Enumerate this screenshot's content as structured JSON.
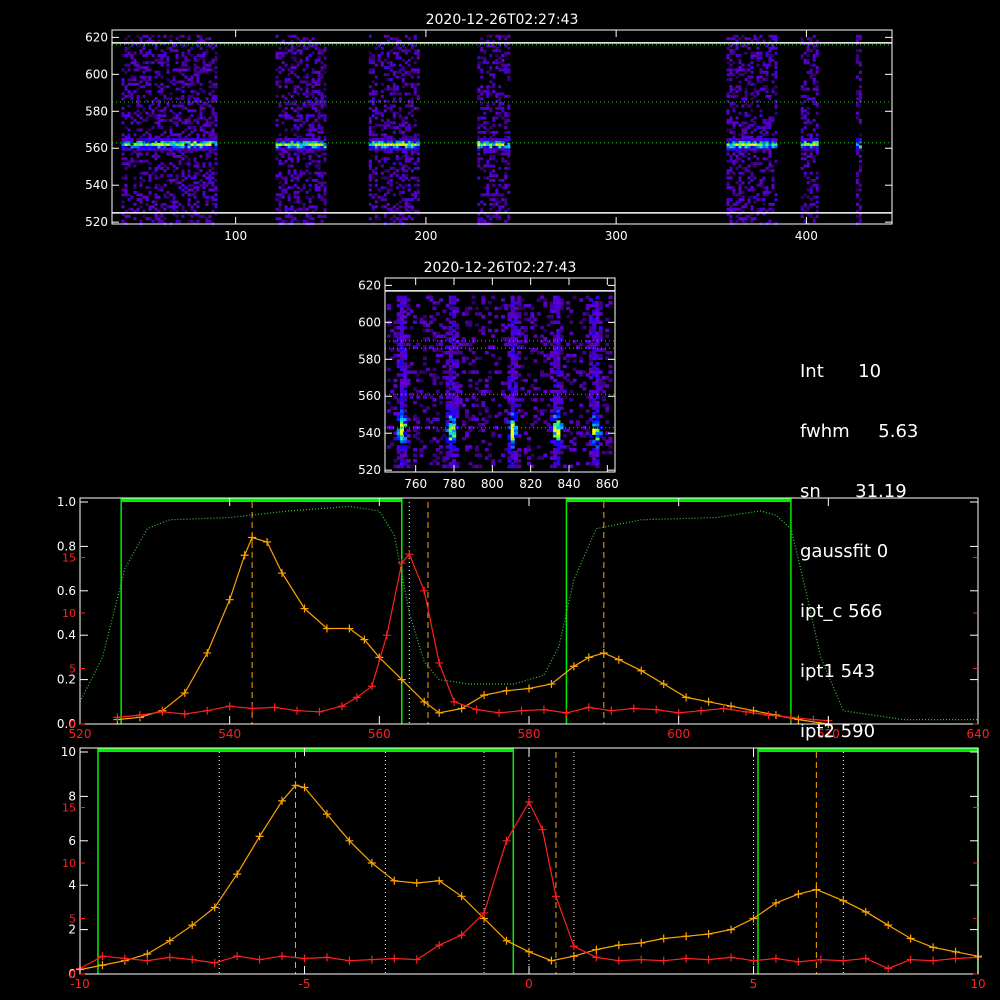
{
  "colors": {
    "background": "#000000",
    "axis": "#ffffff",
    "green_band": "#00ee00",
    "orange": "#ffa500",
    "red": "#ff2020",
    "filter_curve": "#33cc33",
    "guide_lines": "#ffa500"
  },
  "info_panel": {
    "int_label": "Int",
    "int_value": "10",
    "fwhm_label": "fwhm",
    "fwhm_value": "5.63",
    "sn_label": "sn",
    "sn_value": "31.19",
    "gaussfit_label": "gaussfit",
    "gaussfit_value": "0",
    "ipt_c_label": "ipt_c",
    "ipt_c_value": "566",
    "ipt1_label": "ipt1",
    "ipt1_value": "543",
    "ipt2_label": "ipt2",
    "ipt2_value": "590"
  },
  "chart_data": [
    {
      "type": "heatmap",
      "title": "2020-12-26T02:27:43",
      "xlim": [
        35,
        445
      ],
      "ylim": [
        519,
        624
      ],
      "xticks": [
        100,
        200,
        300,
        400
      ],
      "yticks": [
        520,
        540,
        560,
        580,
        600,
        620
      ],
      "hlines_solid": [
        525,
        617
      ],
      "hlines_dotted": [
        563,
        585,
        616
      ],
      "column_bands": [
        [
          40,
          90
        ],
        [
          121,
          147
        ],
        [
          170,
          196
        ],
        [
          227,
          244
        ],
        [
          358,
          384
        ],
        [
          397,
          405
        ],
        [
          426,
          429
        ]
      ],
      "bright_rows": [
        563
      ],
      "colormap": "rainbow"
    },
    {
      "type": "heatmap",
      "title": "2020-12-26T02:27:43",
      "xlim": [
        744,
        864
      ],
      "ylim": [
        519,
        624
      ],
      "xticks": [
        760,
        780,
        800,
        820,
        840,
        860
      ],
      "yticks": [
        520,
        540,
        560,
        580,
        600,
        620
      ],
      "hlines_solid": [
        617
      ],
      "hlines_dotted": [
        543,
        561,
        586,
        590
      ],
      "bright_columns": [
        752,
        778,
        810,
        833,
        853
      ],
      "bright_rows": [
        543
      ],
      "colormap": "rainbow"
    },
    {
      "type": "line",
      "xlim": [
        520,
        640
      ],
      "xticks": [
        520,
        540,
        560,
        580,
        600,
        620,
        640
      ],
      "ylim_left": [
        0,
        1.0
      ],
      "yticks_left": [
        "0.0",
        "0.2",
        "0.4",
        "0.6",
        "0.8",
        "1.0"
      ],
      "ylim_right": [
        0,
        20
      ],
      "yticks_right": [
        "0",
        "5",
        "10",
        "15"
      ],
      "green_bands": [
        [
          525.5,
          563
        ],
        [
          585,
          615
        ]
      ],
      "dashed_lines": [
        543,
        566.5,
        590
      ],
      "dotted_lines": [
        564
      ],
      "series": [
        {
          "color": "orange",
          "axis": "left",
          "markers": true,
          "x": [
            525,
            528,
            531,
            534,
            537,
            540,
            542,
            543,
            545,
            547,
            550,
            553,
            556,
            558,
            560,
            563,
            566,
            568,
            571,
            574,
            577,
            580,
            583,
            586,
            588,
            590,
            592,
            595,
            598,
            601,
            604,
            607,
            610,
            613,
            616,
            620
          ],
          "y": [
            0.02,
            0.03,
            0.06,
            0.14,
            0.32,
            0.56,
            0.76,
            0.84,
            0.82,
            0.68,
            0.52,
            0.43,
            0.43,
            0.38,
            0.3,
            0.2,
            0.1,
            0.05,
            0.07,
            0.13,
            0.15,
            0.16,
            0.18,
            0.26,
            0.3,
            0.32,
            0.29,
            0.24,
            0.18,
            0.12,
            0.1,
            0.08,
            0.06,
            0.04,
            0.02,
            0.0
          ]
        },
        {
          "color": "red",
          "axis": "right",
          "markers": true,
          "x": [
            525,
            528,
            531,
            534,
            537,
            540,
            543,
            546,
            549,
            552,
            555,
            557,
            559,
            561,
            563,
            564,
            566,
            568,
            570,
            573,
            576,
            579,
            582,
            585,
            588,
            591,
            594,
            597,
            600,
            603,
            606,
            609,
            612,
            615,
            618,
            620
          ],
          "y": [
            0.6,
            0.8,
            1.1,
            0.9,
            1.2,
            1.6,
            1.4,
            1.5,
            1.2,
            1.1,
            1.6,
            2.4,
            3.4,
            8.0,
            14.5,
            15.3,
            12.0,
            5.5,
            2.0,
            1.3,
            1.0,
            1.2,
            1.3,
            1.0,
            1.5,
            1.2,
            1.4,
            1.3,
            1.0,
            1.2,
            1.4,
            1.1,
            0.8,
            0.6,
            0.4,
            0.3
          ]
        },
        {
          "color": "filter",
          "axis": "left",
          "markers": false,
          "dotted": true,
          "x": [
            520,
            523,
            526,
            529,
            532,
            540,
            548,
            556,
            560,
            562,
            564,
            566,
            568,
            572,
            578,
            582,
            584,
            586,
            589,
            595,
            605,
            611,
            613,
            615,
            617,
            619,
            622,
            630,
            640
          ],
          "y": [
            0.1,
            0.3,
            0.7,
            0.88,
            0.92,
            0.93,
            0.96,
            0.98,
            0.96,
            0.85,
            0.5,
            0.28,
            0.2,
            0.18,
            0.18,
            0.22,
            0.35,
            0.65,
            0.88,
            0.92,
            0.93,
            0.96,
            0.94,
            0.88,
            0.6,
            0.3,
            0.06,
            0.02,
            0.02
          ]
        }
      ]
    },
    {
      "type": "line",
      "xlim": [
        -10,
        10
      ],
      "xticks": [
        -10,
        -5,
        0,
        5,
        10
      ],
      "ylim_left": [
        0,
        10
      ],
      "yticks_left": [
        "0",
        "2",
        "4",
        "6",
        "8",
        "10"
      ],
      "ylim_right": [
        0,
        20
      ],
      "yticks_right": [
        "0",
        "5",
        "10",
        "15"
      ],
      "green_bands": [
        [
          -9.6,
          -0.35
        ],
        [
          5.1,
          10
        ]
      ],
      "dashed_lines": [
        -5.2,
        0.6,
        6.4
      ],
      "dotted_lines": [
        -6.9,
        -3.2,
        -1.0,
        0.0,
        1.0,
        5.0,
        7.0
      ],
      "series": [
        {
          "color": "orange",
          "axis": "left",
          "markers": true,
          "x": [
            -10,
            -9.5,
            -9,
            -8.5,
            -8,
            -7.5,
            -7,
            -6.5,
            -6,
            -5.5,
            -5.2,
            -5,
            -4.5,
            -4,
            -3.5,
            -3,
            -2.5,
            -2,
            -1.5,
            -1,
            -0.5,
            0,
            0.5,
            1,
            1.5,
            2,
            2.5,
            3,
            3.5,
            4,
            4.5,
            5,
            5.5,
            6,
            6.4,
            7,
            7.5,
            8,
            8.5,
            9,
            9.5,
            10
          ],
          "y": [
            0.2,
            0.4,
            0.6,
            0.9,
            1.5,
            2.2,
            3.0,
            4.5,
            6.2,
            7.8,
            8.5,
            8.4,
            7.2,
            6.0,
            5.0,
            4.2,
            4.1,
            4.2,
            3.5,
            2.5,
            1.5,
            1.0,
            0.6,
            0.8,
            1.1,
            1.3,
            1.4,
            1.6,
            1.7,
            1.8,
            2.0,
            2.5,
            3.2,
            3.6,
            3.8,
            3.3,
            2.8,
            2.2,
            1.6,
            1.2,
            1.0,
            0.8
          ]
        },
        {
          "color": "red",
          "axis": "right",
          "markers": true,
          "x": [
            -10,
            -9.5,
            -9,
            -8.5,
            -8,
            -7.5,
            -7,
            -6.5,
            -6,
            -5.5,
            -5,
            -4.5,
            -4,
            -3.5,
            -3,
            -2.5,
            -2,
            -1.5,
            -1,
            -0.5,
            0,
            0.3,
            0.6,
            1,
            1.5,
            2,
            2.5,
            3,
            3.5,
            4,
            4.5,
            5,
            5.5,
            6,
            6.5,
            7,
            7.5,
            8,
            8.5,
            9,
            9.5,
            10
          ],
          "y": [
            0.5,
            1.6,
            1.4,
            1.2,
            1.5,
            1.3,
            1.0,
            1.6,
            1.3,
            1.6,
            1.4,
            1.5,
            1.2,
            1.3,
            1.4,
            1.3,
            2.6,
            3.5,
            5.5,
            12.0,
            15.5,
            13.0,
            7.0,
            2.5,
            1.5,
            1.2,
            1.3,
            1.2,
            1.4,
            1.3,
            1.5,
            1.2,
            1.4,
            1.1,
            1.3,
            1.2,
            1.4,
            0.5,
            1.3,
            1.2,
            1.4,
            1.5
          ]
        }
      ]
    }
  ]
}
